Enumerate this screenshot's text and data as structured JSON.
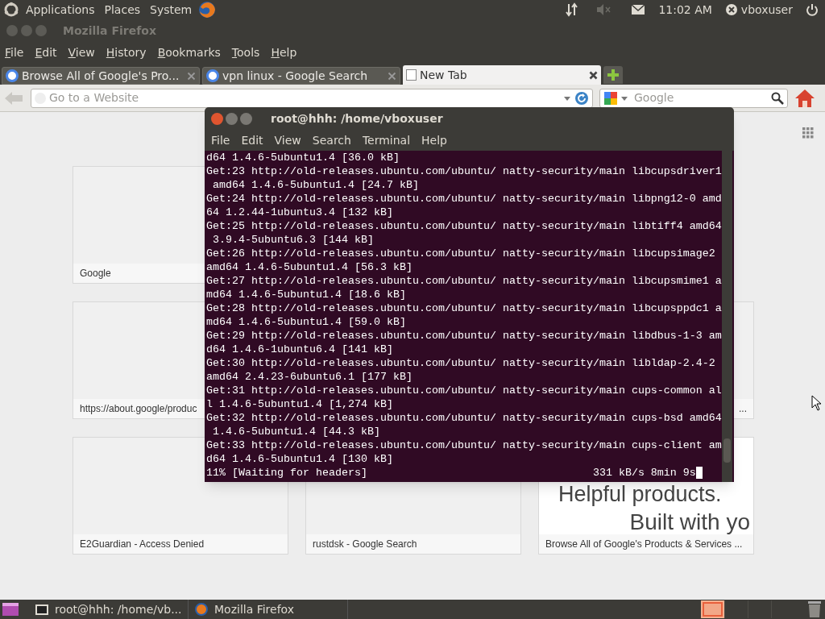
{
  "top_panel": {
    "menus": [
      "Applications",
      "Places",
      "System"
    ],
    "clock": "11:02 AM",
    "user": "vboxuser"
  },
  "firefox": {
    "title": "Mozilla Firefox",
    "menu": [
      "File",
      "Edit",
      "View",
      "History",
      "Bookmarks",
      "Tools",
      "Help"
    ],
    "tabs": [
      {
        "label": "Browse All of Google's Pro...",
        "selected": false,
        "kind": "google"
      },
      {
        "label": "vpn linux - Google Search",
        "selected": false,
        "kind": "google"
      },
      {
        "label": "New Tab",
        "selected": true,
        "kind": "blank"
      }
    ],
    "url_field": {
      "placeholder": "Go to a Website"
    },
    "search_field": {
      "placeholder": "Google"
    },
    "tiles": [
      {
        "label": "Google",
        "kind": "head"
      },
      {
        "kind": "hidden"
      },
      {
        "kind": "hidden"
      },
      {
        "label": "https://about.google/produc",
        "kind": "head"
      },
      {
        "kind": "hidden"
      },
      {
        "label": "...",
        "kind": "tail"
      },
      {
        "label": "E2Guardian - Access Denied",
        "kind": "head"
      },
      {
        "label": "rustdsk - Google Search",
        "kind": "head"
      },
      {
        "label": "Browse All of Google's Products & Services ...",
        "kind": "head",
        "thumbnail": [
          "Helpful products.",
          "Built with yo"
        ]
      }
    ]
  },
  "terminal": {
    "title": "root@hhh: /home/vboxuser",
    "menu": [
      "File",
      "Edit",
      "View",
      "Search",
      "Terminal",
      "Help"
    ],
    "lines": [
      "d64 1.4.6-5ubuntu1.4 [36.0 kB]",
      "Get:23 http://old-releases.ubuntu.com/ubuntu/ natty-security/main libcupsdriver1",
      " amd64 1.4.6-5ubuntu1.4 [24.7 kB]",
      "Get:24 http://old-releases.ubuntu.com/ubuntu/ natty-security/main libpng12-0 amd",
      "64 1.2.44-1ubuntu3.4 [132 kB]",
      "Get:25 http://old-releases.ubuntu.com/ubuntu/ natty-security/main libtiff4 amd64",
      " 3.9.4-5ubuntu6.3 [144 kB]",
      "Get:26 http://old-releases.ubuntu.com/ubuntu/ natty-security/main libcupsimage2",
      "amd64 1.4.6-5ubuntu1.4 [56.3 kB]",
      "Get:27 http://old-releases.ubuntu.com/ubuntu/ natty-security/main libcupsmime1 a",
      "md64 1.4.6-5ubuntu1.4 [18.6 kB]",
      "Get:28 http://old-releases.ubuntu.com/ubuntu/ natty-security/main libcupsppdc1 a",
      "md64 1.4.6-5ubuntu1.4 [59.0 kB]",
      "Get:29 http://old-releases.ubuntu.com/ubuntu/ natty-security/main libdbus-1-3 am",
      "d64 1.4.6-1ubuntu6.4 [141 kB]",
      "Get:30 http://old-releases.ubuntu.com/ubuntu/ natty-security/main libldap-2.4-2",
      "amd64 2.4.23-6ubuntu6.1 [177 kB]",
      "Get:31 http://old-releases.ubuntu.com/ubuntu/ natty-security/main cups-common al",
      "l 1.4.6-5ubuntu1.4 [1,274 kB]",
      "Get:32 http://old-releases.ubuntu.com/ubuntu/ natty-security/main cups-bsd amd64",
      " 1.4.6-5ubuntu1.4 [44.3 kB]",
      "Get:33 http://old-releases.ubuntu.com/ubuntu/ natty-security/main cups-client am",
      "d64 1.4.6-5ubuntu1.4 [130 kB]",
      "11% [Waiting for headers]                                   331 kB/s 8min 9s"
    ]
  },
  "taskbar": {
    "windows": [
      {
        "label": "root@hhh: /home/vb...",
        "kind": "terminal"
      },
      {
        "label": "Mozilla Firefox",
        "kind": "firefox"
      }
    ],
    "workspaces": [
      {
        "selected": true
      },
      {
        "selected": false
      },
      {
        "selected": false
      },
      {
        "selected": false
      }
    ]
  }
}
